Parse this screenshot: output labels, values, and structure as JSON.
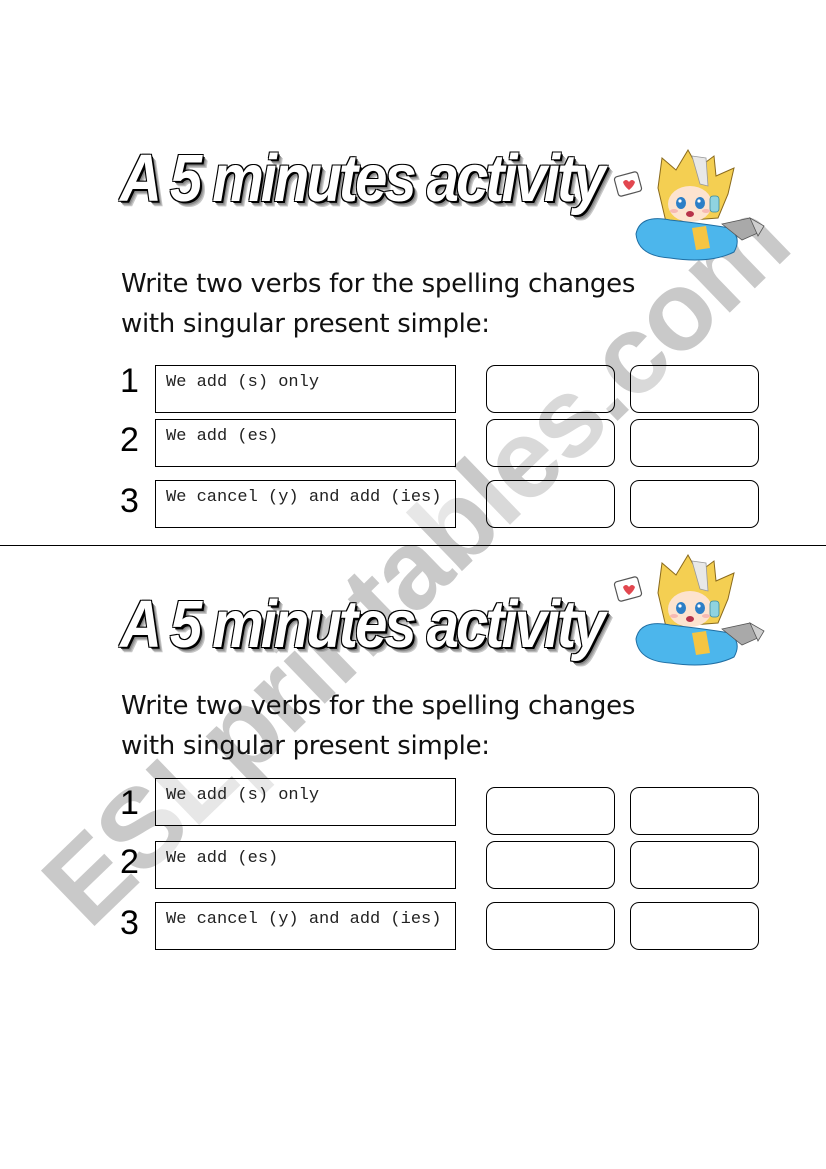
{
  "watermark": "ESLprintables.com",
  "worksheets": [
    {
      "title": "A 5 minutes activity",
      "mascot_icon": "chibi-character-with-heart-bubble",
      "instruction_line1": "Write two verbs for the spelling changes",
      "instruction_line2": "with singular present simple:",
      "rows": [
        {
          "number": "1",
          "rule": "We add (s) only",
          "answers": [
            "",
            ""
          ]
        },
        {
          "number": "2",
          "rule": "We add (es)",
          "answers": [
            "",
            ""
          ]
        },
        {
          "number": "3",
          "rule": "We cancel (y) and add (ies)",
          "answers": [
            "",
            ""
          ]
        }
      ]
    },
    {
      "title": "A 5 minutes activity",
      "mascot_icon": "chibi-character-with-heart-bubble",
      "instruction_line1": "Write two verbs for the spelling changes",
      "instruction_line2": "with singular present simple:",
      "rows": [
        {
          "number": "1",
          "rule": "We add (s) only",
          "answers": [
            "",
            ""
          ]
        },
        {
          "number": "2",
          "rule": "We add (es)",
          "answers": [
            "",
            ""
          ]
        },
        {
          "number": "3",
          "rule": "We cancel (y) and add (ies)",
          "answers": [
            "",
            ""
          ]
        }
      ]
    }
  ]
}
